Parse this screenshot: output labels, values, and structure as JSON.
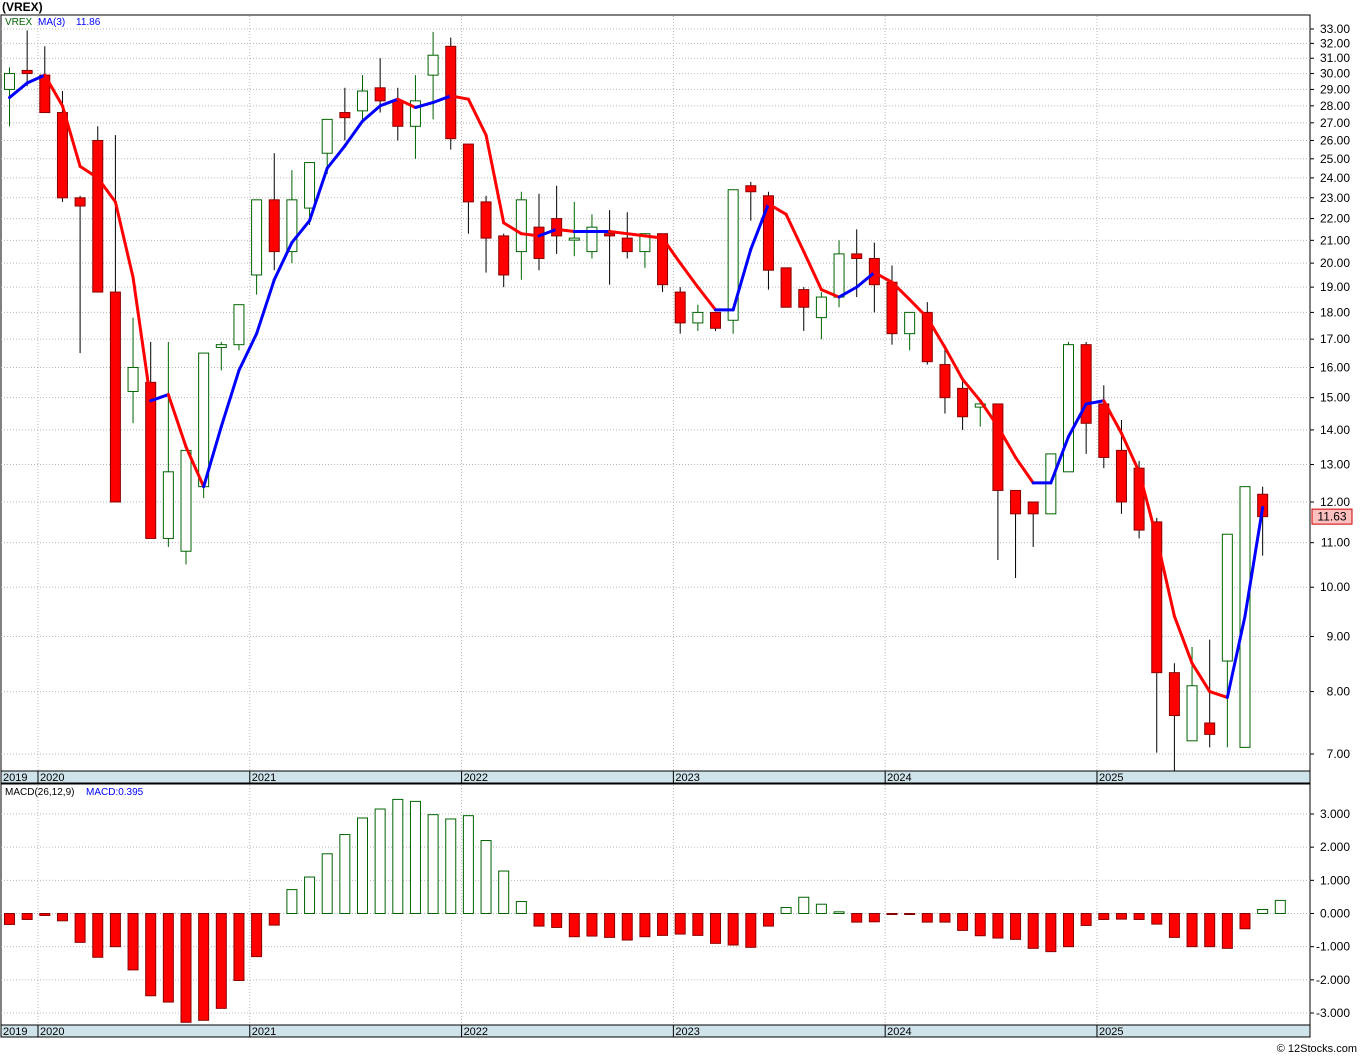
{
  "chart_title": "(VREX)",
  "price_panel": {
    "ticker_label": "VREX",
    "ma_label": "MA(3)",
    "ma_value": "11.86",
    "last_price_label": "11.63",
    "y_ticks": [
      "33.00",
      "32.00",
      "31.00",
      "30.00",
      "29.00",
      "28.00",
      "27.00",
      "26.00",
      "25.00",
      "24.00",
      "23.00",
      "22.00",
      "21.00",
      "20.00",
      "19.00",
      "18.00",
      "17.00",
      "16.00",
      "15.00",
      "14.00",
      "13.00",
      "12.00",
      "11.00",
      "10.00",
      "9.00",
      "8.00",
      "7.00"
    ],
    "scale": "log"
  },
  "macd_panel": {
    "label": "MACD(26,12,9)",
    "value_label": "MACD:0.395",
    "y_ticks": [
      "3.000",
      "2.000",
      "1.000",
      "0.000",
      "-1.000",
      "-2.000",
      "-3.000"
    ]
  },
  "x_year_labels": [
    "2019",
    "2020",
    "2021",
    "2022",
    "2023",
    "2024",
    "2025"
  ],
  "credit": "© 12Stocks.com",
  "colors": {
    "up": "#ffffff",
    "up_outline": "#006400",
    "down": "#ff0000",
    "ma_up": "#0000ff",
    "ma_down": "#ff0000",
    "macd_pos": "#006400",
    "macd_neg": "#ff0000",
    "axis_band": "#cfe3ea",
    "last_price_bg": "#ffc0c0"
  },
  "chart_data": {
    "type": "candlestick",
    "interval": "monthly",
    "title": "(VREX)",
    "months": [
      "2019-11",
      "2019-12",
      "2020-01",
      "2020-02",
      "2020-03",
      "2020-04",
      "2020-05",
      "2020-06",
      "2020-07",
      "2020-08",
      "2020-09",
      "2020-10",
      "2020-11",
      "2020-12",
      "2021-01",
      "2021-02",
      "2021-03",
      "2021-04",
      "2021-05",
      "2021-06",
      "2021-07",
      "2021-08",
      "2021-09",
      "2021-10",
      "2021-11",
      "2021-12",
      "2022-01",
      "2022-02",
      "2022-03",
      "2022-04",
      "2022-05",
      "2022-06",
      "2022-07",
      "2022-08",
      "2022-09",
      "2022-10",
      "2022-11",
      "2022-12",
      "2023-01",
      "2023-02",
      "2023-03",
      "2023-04",
      "2023-05",
      "2023-06",
      "2023-07",
      "2023-08",
      "2023-09",
      "2023-10",
      "2023-11",
      "2023-12",
      "2024-01",
      "2024-02",
      "2024-03",
      "2024-04",
      "2024-05",
      "2024-06",
      "2024-07",
      "2024-08",
      "2024-09",
      "2024-10",
      "2024-11",
      "2024-12",
      "2025-01",
      "2025-02",
      "2025-03",
      "2025-04",
      "2025-05",
      "2025-06",
      "2025-07",
      "2025-08",
      "2025-09",
      "2025-10"
    ],
    "open": [
      29.0,
      30.2,
      29.9,
      27.6,
      23.0,
      26.0,
      18.8,
      15.2,
      15.5,
      11.1,
      10.8,
      12.4,
      16.7,
      16.8,
      19.5,
      22.9,
      20.5,
      22.5,
      25.3,
      27.6,
      27.7,
      29.1,
      28.3,
      26.8,
      29.9,
      31.8,
      25.8,
      22.8,
      21.2,
      20.5,
      21.6,
      22.0,
      21.1,
      20.5,
      21.3,
      21.1,
      20.5,
      21.3,
      18.8,
      17.6,
      18.0,
      17.7,
      23.6,
      23.1,
      19.8,
      18.9,
      17.8,
      18.6,
      20.4,
      20.2,
      19.2,
      17.2,
      18.0,
      16.1,
      15.3,
      14.7,
      14.8,
      12.3,
      12.0,
      11.7,
      12.8,
      16.8,
      14.8,
      13.4,
      12.9,
      11.5,
      8.33,
      7.2,
      7.48,
      8.54,
      7.1,
      12.2
    ],
    "close": [
      30.0,
      30.0,
      27.6,
      23.0,
      22.6,
      18.8,
      12.0,
      16.0,
      11.1,
      12.8,
      13.4,
      16.5,
      16.8,
      18.3,
      22.9,
      20.5,
      22.9,
      24.8,
      27.2,
      27.3,
      28.9,
      28.3,
      26.8,
      28.3,
      31.2,
      26.1,
      22.8,
      21.1,
      19.5,
      22.9,
      20.2,
      21.2,
      21.1,
      21.6,
      21.2,
      20.5,
      21.3,
      19.1,
      17.6,
      18.0,
      17.4,
      23.4,
      23.3,
      19.7,
      18.2,
      18.2,
      18.6,
      20.4,
      20.2,
      19.1,
      17.2,
      18.0,
      16.2,
      15.0,
      14.4,
      14.8,
      12.3,
      11.7,
      11.7,
      13.3,
      16.8,
      14.2,
      13.2,
      12.0,
      11.3,
      8.33,
      7.6,
      8.1,
      7.3,
      11.2,
      12.4,
      11.63
    ],
    "high": [
      30.4,
      32.9,
      31.8,
      28.9,
      23.1,
      26.8,
      26.3,
      17.8,
      16.9,
      16.9,
      12.9,
      14.5,
      16.9,
      17.0,
      20.5,
      25.3,
      24.4,
      23.3,
      26.7,
      29.1,
      29.9,
      31.0,
      29.1,
      29.9,
      32.8,
      32.4,
      25.5,
      23.1,
      21.3,
      23.3,
      23.2,
      23.6,
      22.8,
      22.2,
      22.4,
      22.3,
      21.3,
      21.3,
      19.0,
      18.3,
      18.0,
      22.5,
      23.8,
      23.3,
      19.8,
      19.0,
      18.8,
      21.0,
      21.5,
      20.9,
      19.9,
      17.4,
      18.4,
      16.8,
      15.6,
      14.9,
      14.8,
      12.3,
      12.0,
      13.3,
      16.9,
      16.9,
      15.4,
      14.3,
      13.1,
      11.6,
      8.5,
      8.8,
      8.94,
      8.8,
      11.8,
      12.4
    ],
    "low": [
      26.8,
      29.2,
      28.6,
      22.8,
      16.5,
      21.8,
      17.0,
      14.2,
      14.5,
      10.9,
      10.5,
      12.1,
      15.9,
      16.6,
      18.7,
      19.7,
      20.0,
      21.7,
      24.2,
      26.0,
      27.2,
      27.6,
      26.0,
      25.0,
      27.2,
      25.5,
      21.3,
      19.6,
      19.0,
      19.3,
      19.7,
      20.4,
      20.3,
      20.2,
      19.1,
      20.2,
      19.8,
      18.8,
      17.2,
      17.3,
      17.3,
      17.2,
      21.9,
      18.9,
      18.4,
      17.3,
      17.0,
      18.2,
      18.6,
      18.0,
      16.8,
      16.6,
      16.1,
      14.5,
      14.0,
      14.1,
      10.6,
      10.2,
      10.9,
      12.9,
      14.0,
      13.3,
      12.9,
      11.7,
      11.1,
      7.02,
      6.74,
      7.53,
      7.1,
      7.1,
      11.2,
      10.7
    ],
    "ma3": [
      28.5,
      29.4,
      29.9,
      28.0,
      24.6,
      24.0,
      22.8,
      19.4,
      14.9,
      15.1,
      13.5,
      12.4,
      14.1,
      15.9,
      17.2,
      19.3,
      20.9,
      21.9,
      24.5,
      25.7,
      27.1,
      28.0,
      28.4,
      27.9,
      28.2,
      28.6,
      28.4,
      26.3,
      21.8,
      21.3,
      21.2,
      21.5,
      21.4,
      21.4,
      21.4,
      21.3,
      21.2,
      21.1,
      20.0,
      19.0,
      18.1,
      18.1,
      20.6,
      22.7,
      22.2,
      20.5,
      18.9,
      18.6,
      19.0,
      19.6,
      19.2,
      18.5,
      17.8,
      16.7,
      15.6,
      14.9,
      14.1,
      13.2,
      12.5,
      12.5,
      13.8,
      14.8,
      14.9,
      13.9,
      12.8,
      11.1,
      9.4,
      8.5,
      8.0,
      7.9,
      9.4,
      11.86
    ],
    "macd_hist": [
      -0.33,
      -0.18,
      -0.06,
      -0.22,
      -0.87,
      -1.32,
      -1.0,
      -1.7,
      -2.48,
      -2.67,
      -3.28,
      -3.22,
      -2.86,
      -2.02,
      -1.3,
      -0.35,
      0.72,
      1.1,
      1.8,
      2.38,
      2.88,
      3.15,
      3.44,
      3.38,
      2.98,
      2.85,
      2.95,
      2.2,
      1.28,
      0.36,
      -0.38,
      -0.42,
      -0.7,
      -0.68,
      -0.72,
      -0.8,
      -0.7,
      -0.66,
      -0.62,
      -0.66,
      -0.9,
      -0.95,
      -1.02,
      -0.38,
      0.18,
      0.49,
      0.28,
      0.05,
      -0.26,
      -0.25,
      -0.02,
      -0.03,
      -0.26,
      -0.26,
      -0.51,
      -0.67,
      -0.74,
      -0.78,
      -1.05,
      -1.15,
      -1.0,
      -0.36,
      -0.18,
      -0.17,
      -0.18,
      -0.32,
      -0.72,
      -1.0,
      -1.0,
      -1.05,
      -0.46,
      0.12,
      0.395
    ]
  }
}
